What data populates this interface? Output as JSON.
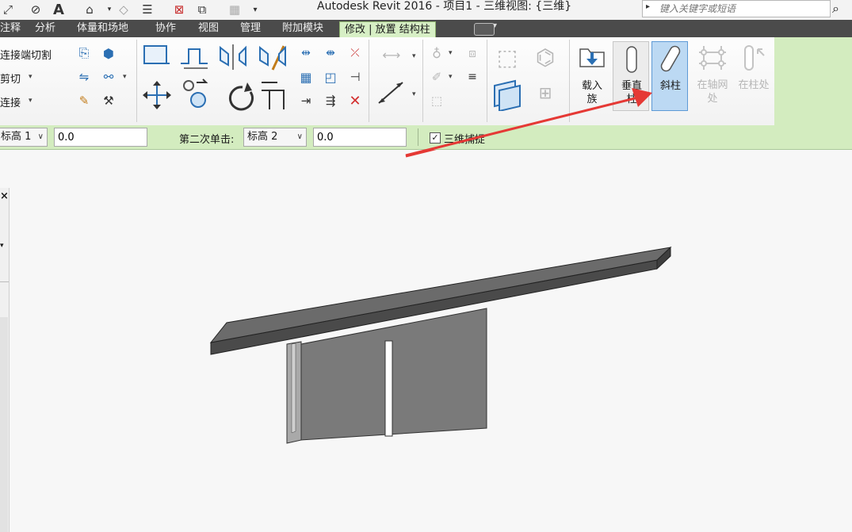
{
  "window": {
    "title": "Autodesk Revit 2016 -     项目1 - 三维视图: {三维}"
  },
  "search": {
    "placeholder": "键入关键字或短语"
  },
  "quick_access_icons": [
    "measure-icon",
    "dimension-icon",
    "text-icon",
    "3d-view-icon",
    "section-icon",
    "thin-lines-icon",
    "close-hidden-icon",
    "switch-windows-icon",
    "tile-icon",
    "dropdown-icon"
  ],
  "tabs": [
    "注释",
    "分析",
    "体量和场地",
    "协作",
    "视图",
    "管理",
    "附加模块",
    "修改 | 放置 结构柱"
  ],
  "active_tab_index": 7,
  "geometry_panel": {
    "cut_join": "连接端切割",
    "cut": "剪切",
    "join": "连接"
  },
  "buttons": {
    "load_family": "载入族",
    "vertical_column": "垂直柱",
    "slanted_column": "斜柱",
    "at_grids": "在轴网处",
    "at_columns": "在柱处"
  },
  "options_bar": {
    "first_level": "标高 1",
    "first_offset": "0.0",
    "second_click_label": "第二次单击:",
    "second_level": "标高 2",
    "second_offset": "0.0",
    "snap_3d_label": "三维捕捉",
    "snap_3d_checked": true
  },
  "colors": {
    "ribbon_green": "#d3ecbf",
    "tab_dark": "#4b4b4b",
    "arrow_red": "#e53935",
    "selected_blue": "#bcd9f3"
  }
}
